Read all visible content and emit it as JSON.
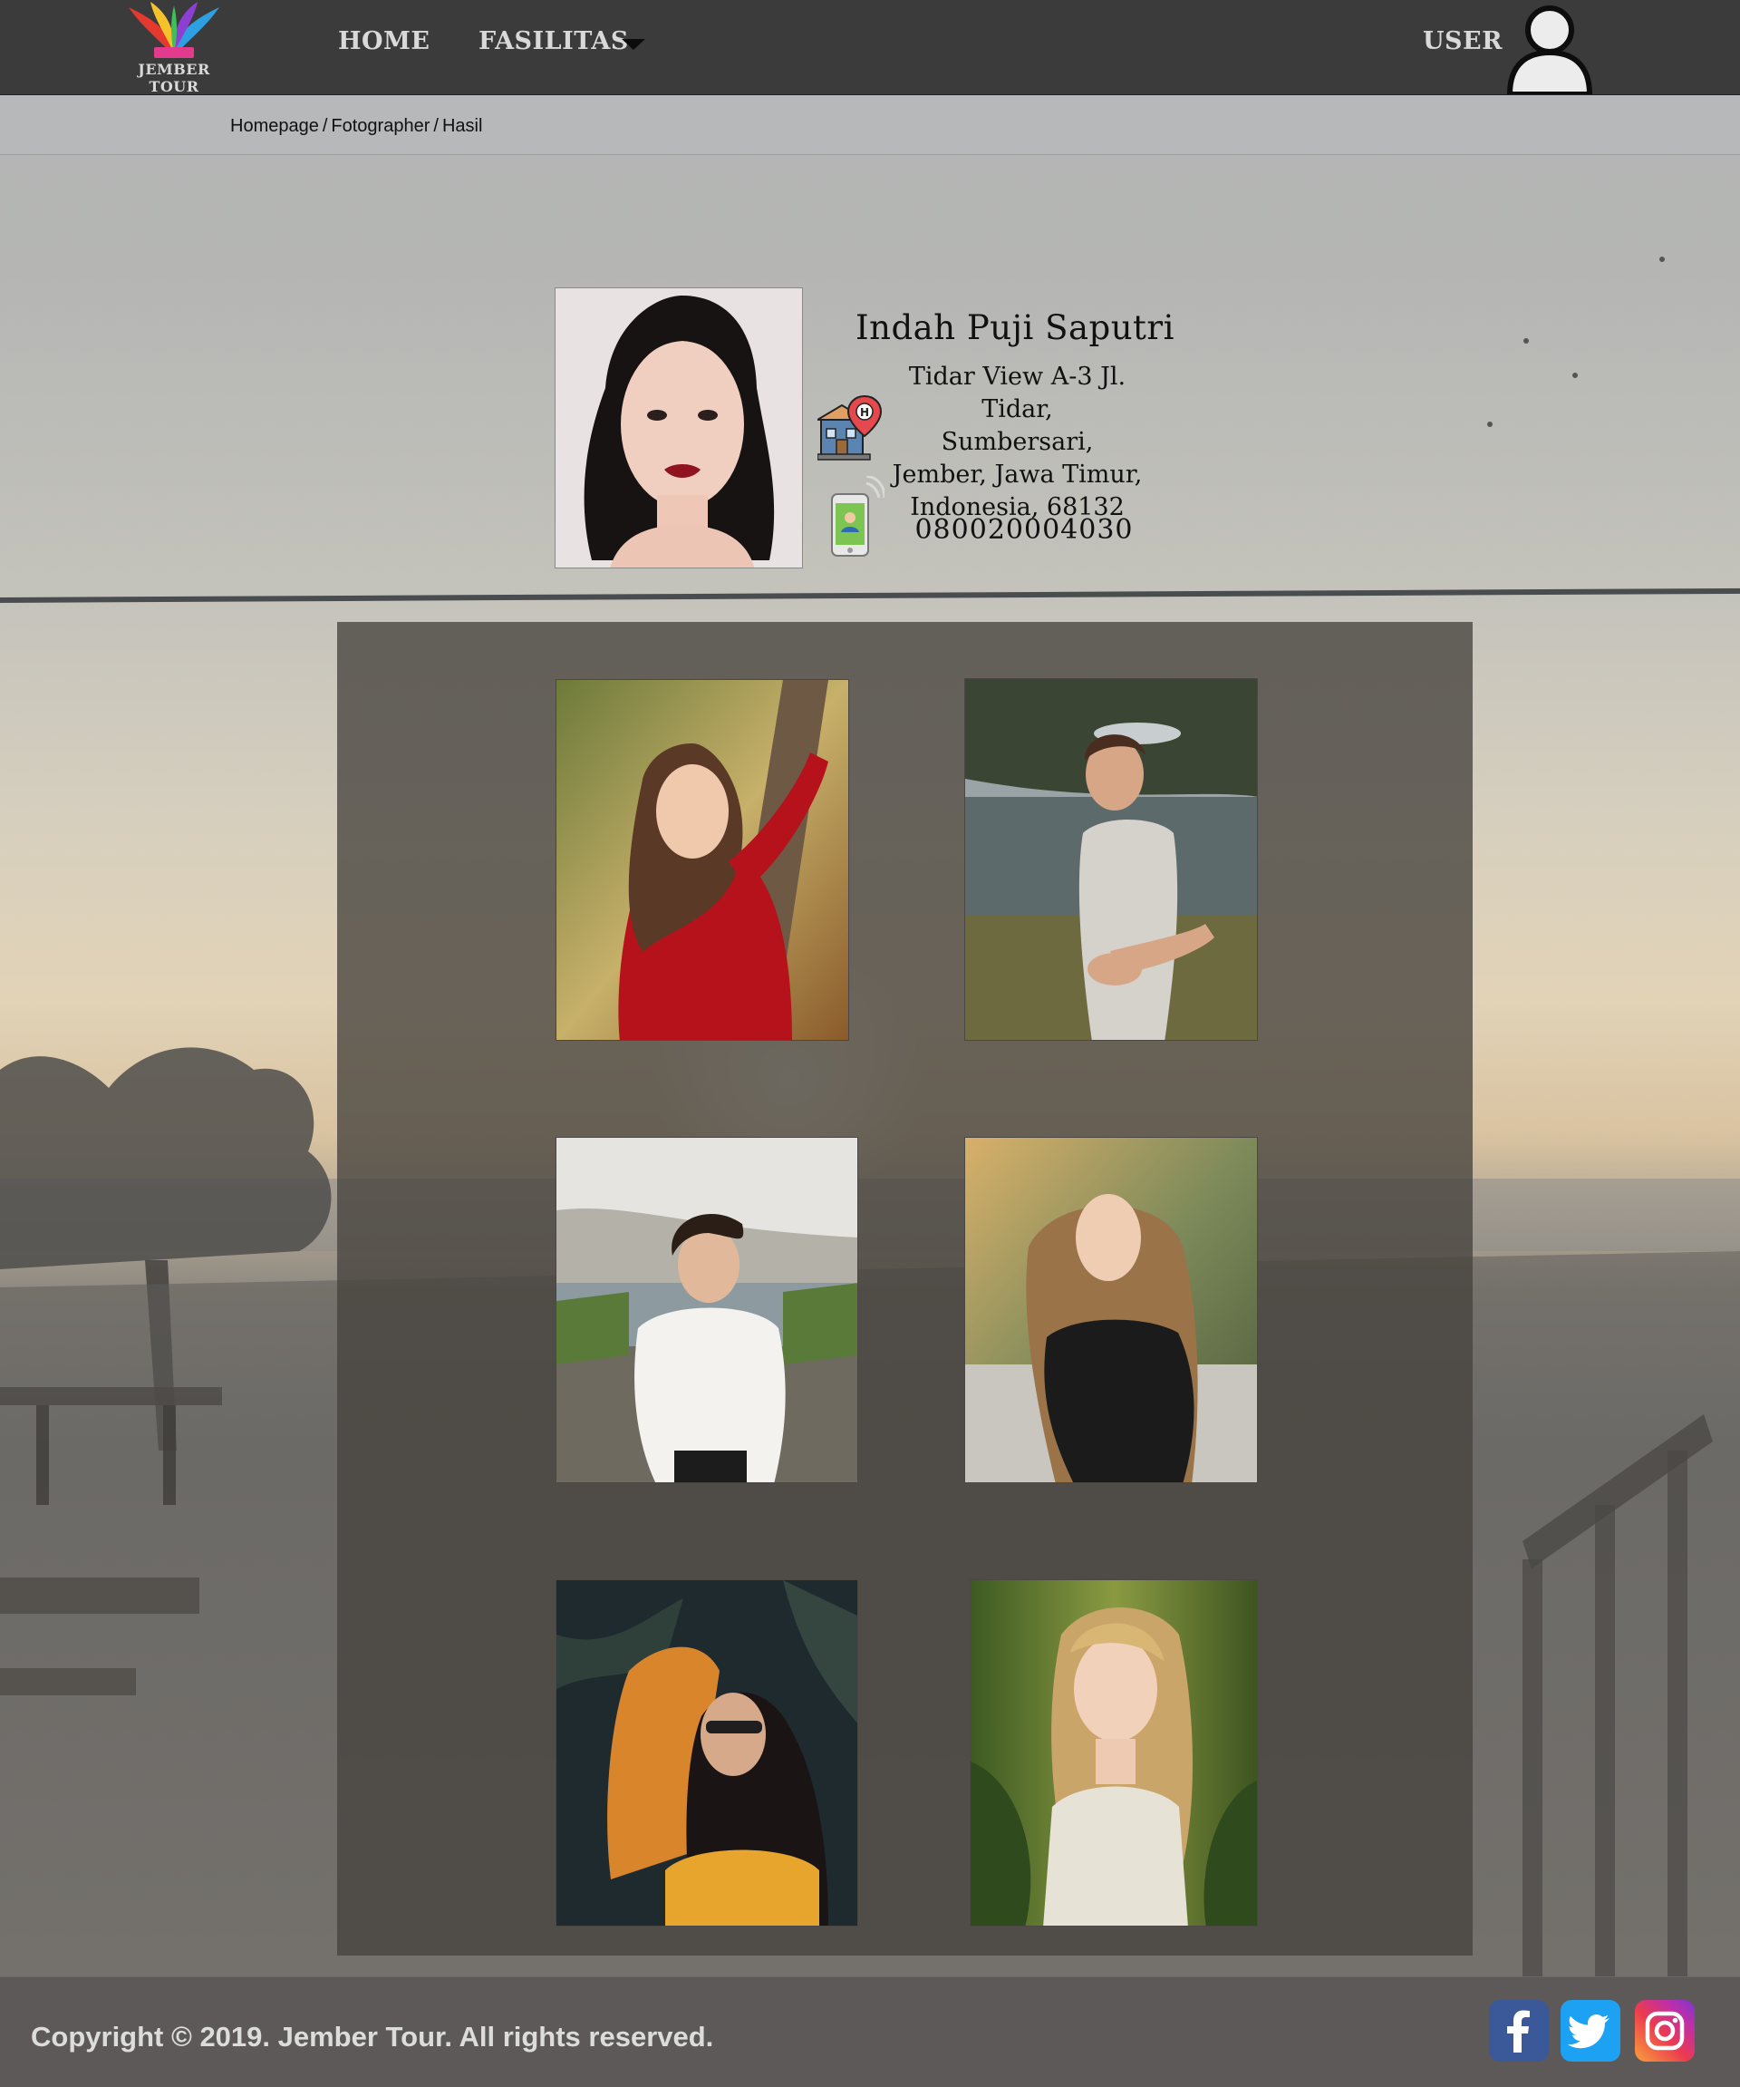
{
  "header": {
    "logo_text": "JEMBER TOUR",
    "nav": [
      {
        "label": "HOME"
      },
      {
        "label": "FASILITAS"
      }
    ],
    "user_label": "USER"
  },
  "breadcrumb": {
    "items": [
      "Homepage",
      "Fotographer",
      "Hasil"
    ],
    "separator": "/"
  },
  "profile": {
    "name": "Indah Puji Saputri",
    "address_lines": [
      "Tidar View A-3 Jl. Tidar,",
      "Sumbersari,",
      "Jember, Jawa Timur,",
      "Indonesia, 68132"
    ],
    "phone": "080020004030",
    "address_icon": "hotel-location-icon",
    "phone_icon": "mobile-phone-icon"
  },
  "gallery": {
    "photos": [
      {
        "icon": "girl-red-sweater-tree-photo"
      },
      {
        "icon": "boy-lake-outstretched-hand-photo"
      },
      {
        "icon": "boy-white-shirt-marsh-photo"
      },
      {
        "icon": "girl-leather-jacket-photo"
      },
      {
        "icon": "girl-sunglasses-palm-photo"
      },
      {
        "icon": "blonde-girl-foliage-photo"
      }
    ]
  },
  "footer": {
    "copyright": "Copyright © 2019. Jember Tour. All rights reserved.",
    "social": [
      {
        "name": "facebook-icon",
        "color": "#3b5998"
      },
      {
        "name": "twitter-icon",
        "color": "#1da1f2"
      },
      {
        "name": "instagram-icon",
        "color": "#c02fa6"
      }
    ]
  },
  "colors": {
    "header_bg": "#3b3b3c",
    "breadcrumb_bg": "#b6b8b9",
    "gallery_panel": "#46423e",
    "footer_bg": "#5e5959"
  }
}
